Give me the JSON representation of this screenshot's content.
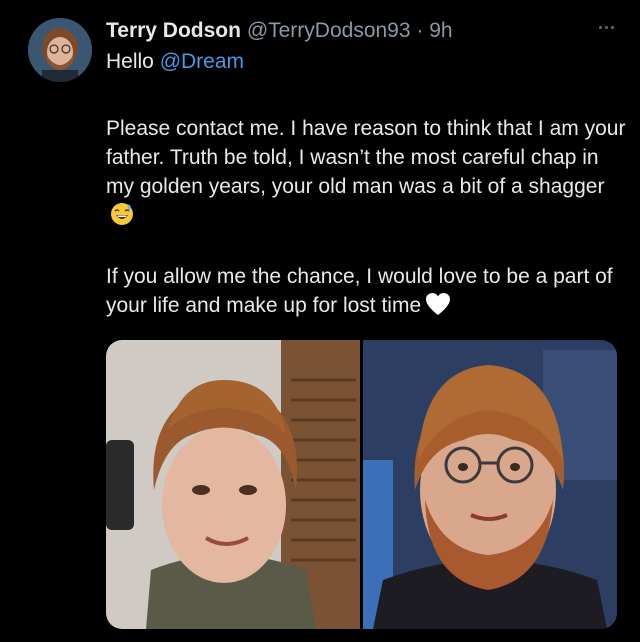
{
  "tweet": {
    "display_name": "Terry Dodson",
    "handle": "@TerryDodson93",
    "separator": "·",
    "time": "9h",
    "reply_prefix": "Hello",
    "reply_mention": "@Dream",
    "paragraph1": "Please contact me. I have reason to think that I am your father. Truth be told, I wasn’t the most careful chap in my golden years, your old man was a bit of a shagger",
    "paragraph2": "If you allow me the chance, I would love to be a part of your life and make up for lost time",
    "paragraph1_emoji": "sweat-smile-emoji",
    "paragraph2_emoji": "white-heart-emoji"
  },
  "media": {
    "count": 2
  },
  "colors": {
    "background": "#000000",
    "text": "#e7e9ea",
    "secondary": "#8b98a5",
    "mention": "#4a97e8"
  }
}
